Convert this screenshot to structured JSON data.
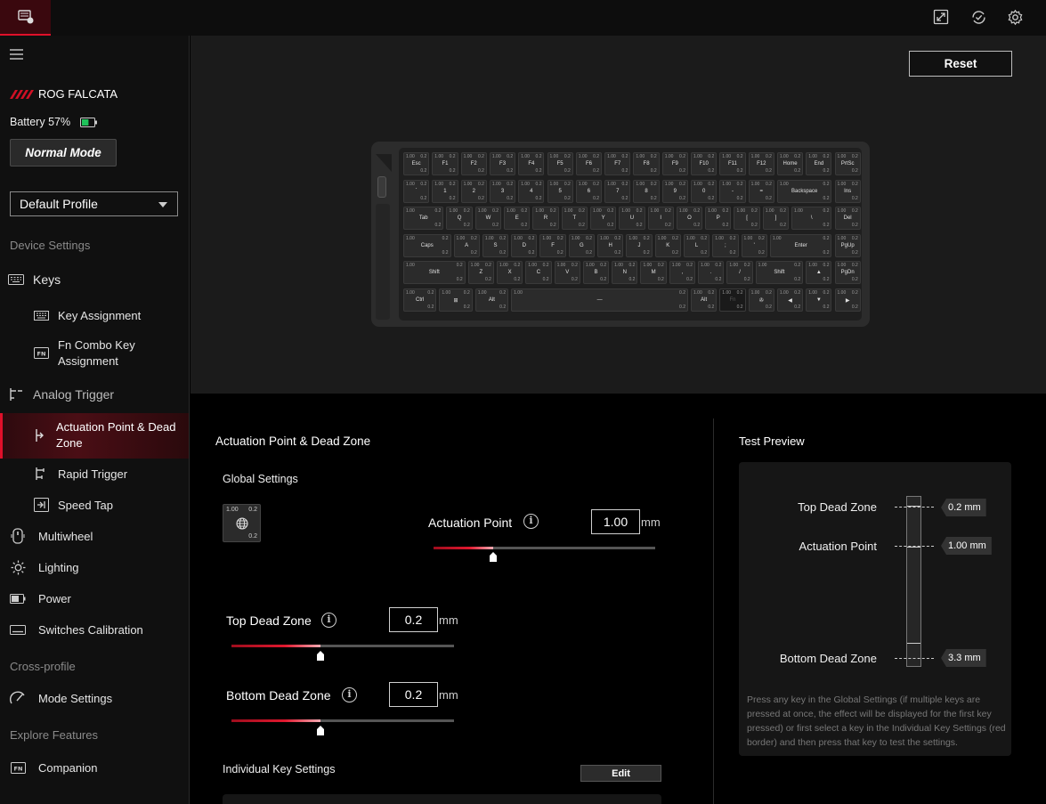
{
  "device": {
    "name": "ROG FALCATA",
    "battery": "Battery 57%",
    "battery_level": 0.57,
    "mode_button": "Normal Mode"
  },
  "profile": {
    "selected": "Default Profile"
  },
  "sidebar": {
    "section_device": "Device Settings",
    "keys": "Keys",
    "key_assignment": "Key Assignment",
    "fn_combo": "Fn Combo Key Assignment",
    "analog_trigger": "Analog Trigger",
    "actuation": "Actuation Point & Dead Zone",
    "rapid_trigger": "Rapid Trigger",
    "speed_tap": "Speed Tap",
    "multiwheel": "Multiwheel",
    "lighting": "Lighting",
    "power": "Power",
    "switches_calibration": "Switches Calibration",
    "section_cross": "Cross-profile",
    "mode_settings": "Mode Settings",
    "section_explore": "Explore Features",
    "companion": "Companion"
  },
  "toolbar": {
    "reset": "Reset"
  },
  "keyboard": {
    "key_values": {
      "actuation": "1.00",
      "top": "0.2",
      "bottom": "0.2"
    },
    "rows": [
      [
        "Esc",
        "F1",
        "F2",
        "F3",
        "F4",
        "F5",
        "F6",
        "F7",
        "F8",
        "F9",
        "F10",
        "F11",
        "F12",
        "Home",
        "End",
        "PrtSc"
      ],
      [
        "`",
        "1",
        "2",
        "3",
        "4",
        "5",
        "6",
        "7",
        "8",
        "9",
        "0",
        "-",
        "=",
        "Backspace",
        "Ins"
      ],
      [
        "Tab",
        "Q",
        "W",
        "E",
        "R",
        "T",
        "Y",
        "U",
        "I",
        "O",
        "P",
        "[",
        "]",
        "\\",
        "Del"
      ],
      [
        "Caps",
        "A",
        "S",
        "D",
        "F",
        "G",
        "H",
        "J",
        "K",
        "L",
        ";",
        "'",
        "Enter",
        "PgUp"
      ],
      [
        "Shift",
        "Z",
        "X",
        "C",
        "V",
        "B",
        "N",
        "M",
        ",",
        ".",
        "/",
        "Shift",
        "▲",
        "PgDn"
      ],
      [
        "Ctrl",
        "⊞",
        "Alt",
        "—",
        "Alt",
        "Fn",
        "✇",
        "◀",
        "▼",
        "▶"
      ]
    ]
  },
  "settings": {
    "title": "Actuation Point & Dead Zone",
    "global": "Global Settings",
    "global_key": {
      "actuation": "1.00",
      "top": "0.2",
      "bottom": "0.2"
    },
    "actuation_label": "Actuation Point",
    "actuation_value": "1.00",
    "actuation_level": 0.27,
    "top_label": "Top Dead Zone",
    "top_value": "0.2",
    "top_level": 0.4,
    "bottom_label": "Bottom Dead Zone",
    "bottom_value": "0.2",
    "bottom_level": 0.4,
    "unit": "mm",
    "individual": "Individual Key Settings",
    "edit": "Edit"
  },
  "test_preview": {
    "title": "Test Preview",
    "top_label": "Top Dead Zone",
    "top_value": "0.2 mm",
    "act_label": "Actuation Point",
    "act_value": "1.00 mm",
    "bottom_label": "Bottom Dead Zone",
    "bottom_value": "3.3 mm",
    "note": "Press any key in the Global Settings (if multiple keys are pressed at once, the effect will be displayed for the first key pressed) or first select a key in the Individual Key Settings (red border) and then press that key to test the settings."
  }
}
